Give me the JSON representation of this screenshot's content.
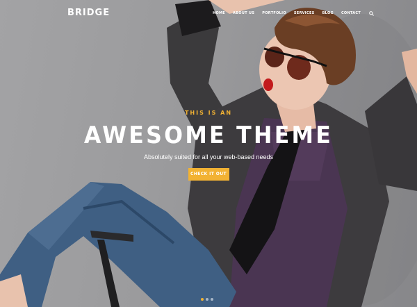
{
  "header": {
    "logo": "BRIDGE",
    "nav": [
      {
        "label": "HOME"
      },
      {
        "label": "ABOUT US"
      },
      {
        "label": "PORTFOLIO"
      },
      {
        "label": "SERVICES"
      },
      {
        "label": "BLOG"
      },
      {
        "label": "CONTACT"
      }
    ],
    "search_icon": "search-icon"
  },
  "hero": {
    "kicker": "THIS IS AN",
    "headline": "AWESOME THEME",
    "subtitle": "Absolutely suited for all your web-based needs",
    "cta_label": "CHECK IT OUT",
    "slides": 3,
    "active_slide": 1
  },
  "colors": {
    "accent": "#f2b233",
    "text": "#ffffff",
    "background": "#9b9b9d"
  }
}
